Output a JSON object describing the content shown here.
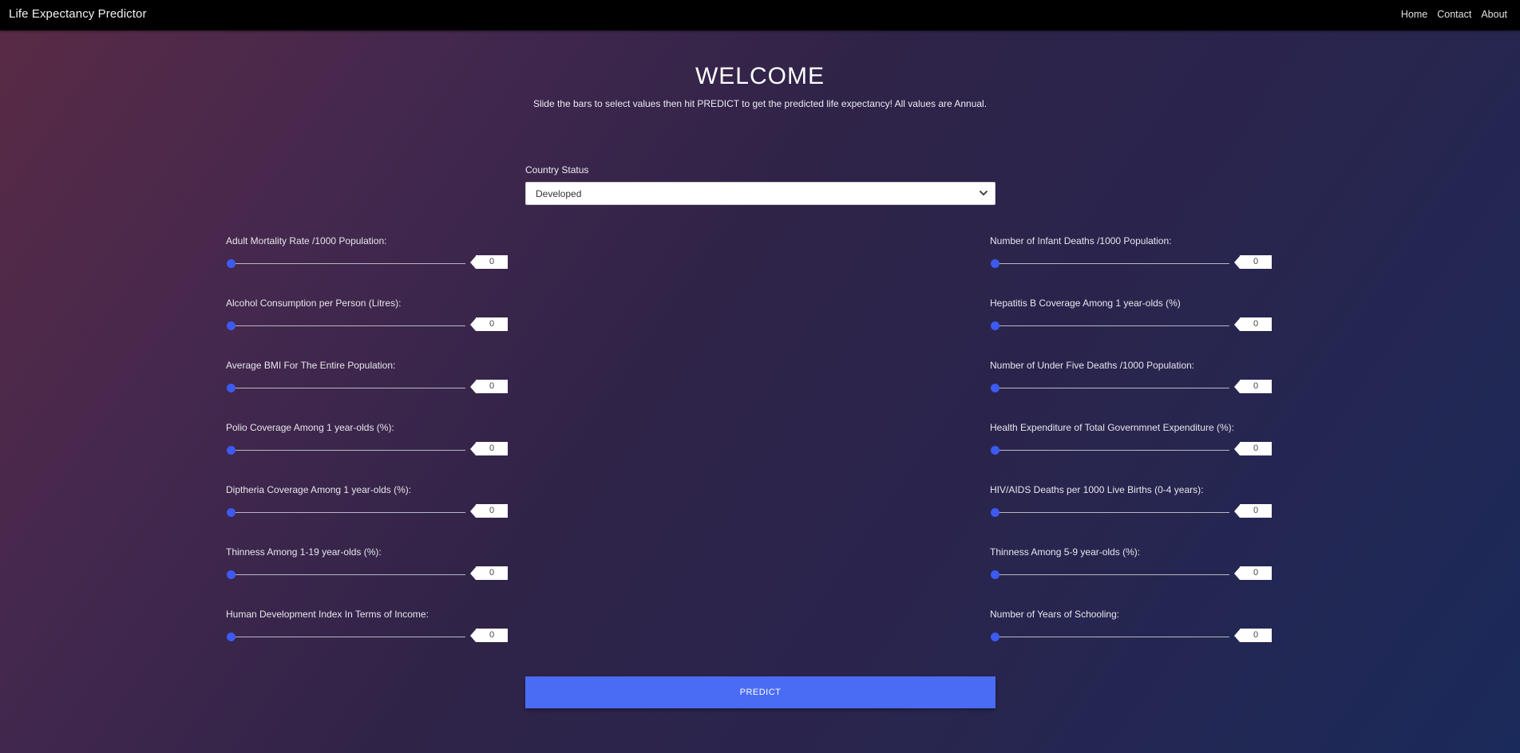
{
  "navbar": {
    "brand": "Life Expectancy Predictor",
    "links": [
      "Home",
      "Contact",
      "About"
    ]
  },
  "header": {
    "title": "WELCOME",
    "subtitle": "Slide the bars to select values then hit PREDICT to get the predicted life expectancy! All values are Annual."
  },
  "country_status": {
    "label": "Country Status",
    "selected": "Developed"
  },
  "colors": {
    "accent": "#3d5af1",
    "button": "#4a6cf5",
    "navbar": "#000000"
  },
  "left_sliders": [
    {
      "label": "Adult Mortality Rate /1000 Population:",
      "value": "0"
    },
    {
      "label": "Alcohol Consumption per Person (Litres):",
      "value": "0"
    },
    {
      "label": "Average BMI For The Entire Population:",
      "value": "0"
    },
    {
      "label": "Polio Coverage Among 1 year-olds (%):",
      "value": "0"
    },
    {
      "label": "Diptheria Coverage Among 1 year-olds (%):",
      "value": "0"
    },
    {
      "label": "Thinness Among 1-19 year-olds (%):",
      "value": "0"
    },
    {
      "label": "Human Development Index In Terms of Income:",
      "value": "0"
    }
  ],
  "right_sliders": [
    {
      "label": "Number of Infant Deaths /1000 Population:",
      "value": "0"
    },
    {
      "label": "Hepatitis B Coverage Among 1 year-olds (%)",
      "value": "0"
    },
    {
      "label": "Number of Under Five Deaths /1000 Population:",
      "value": "0"
    },
    {
      "label": "Health Expenditure of Total Governmnet Expenditure (%):",
      "value": "0"
    },
    {
      "label": "HIV/AIDS Deaths per 1000 Live Births (0-4 years):",
      "value": "0"
    },
    {
      "label": "Thinness Among 5-9 year-olds (%):",
      "value": "0"
    },
    {
      "label": "Number of Years of Schooling:",
      "value": "0"
    }
  ],
  "predict_label": "PREDICT"
}
